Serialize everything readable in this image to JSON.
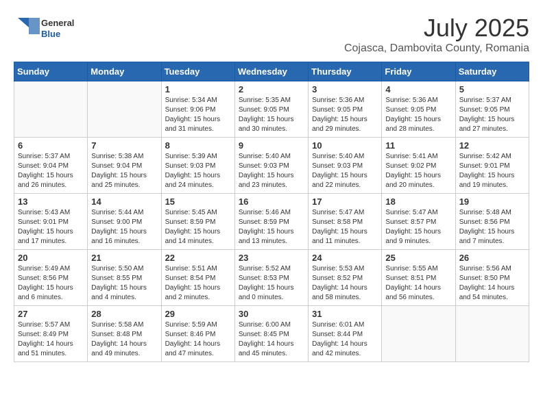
{
  "logo": {
    "general": "General",
    "blue": "Blue"
  },
  "title": "July 2025",
  "subtitle": "Cojasca, Dambovita County, Romania",
  "days_of_week": [
    "Sunday",
    "Monday",
    "Tuesday",
    "Wednesday",
    "Thursday",
    "Friday",
    "Saturday"
  ],
  "weeks": [
    [
      {
        "day": "",
        "content": ""
      },
      {
        "day": "",
        "content": ""
      },
      {
        "day": "1",
        "content": "Sunrise: 5:34 AM\nSunset: 9:06 PM\nDaylight: 15 hours\nand 31 minutes."
      },
      {
        "day": "2",
        "content": "Sunrise: 5:35 AM\nSunset: 9:05 PM\nDaylight: 15 hours\nand 30 minutes."
      },
      {
        "day": "3",
        "content": "Sunrise: 5:36 AM\nSunset: 9:05 PM\nDaylight: 15 hours\nand 29 minutes."
      },
      {
        "day": "4",
        "content": "Sunrise: 5:36 AM\nSunset: 9:05 PM\nDaylight: 15 hours\nand 28 minutes."
      },
      {
        "day": "5",
        "content": "Sunrise: 5:37 AM\nSunset: 9:05 PM\nDaylight: 15 hours\nand 27 minutes."
      }
    ],
    [
      {
        "day": "6",
        "content": "Sunrise: 5:37 AM\nSunset: 9:04 PM\nDaylight: 15 hours\nand 26 minutes."
      },
      {
        "day": "7",
        "content": "Sunrise: 5:38 AM\nSunset: 9:04 PM\nDaylight: 15 hours\nand 25 minutes."
      },
      {
        "day": "8",
        "content": "Sunrise: 5:39 AM\nSunset: 9:03 PM\nDaylight: 15 hours\nand 24 minutes."
      },
      {
        "day": "9",
        "content": "Sunrise: 5:40 AM\nSunset: 9:03 PM\nDaylight: 15 hours\nand 23 minutes."
      },
      {
        "day": "10",
        "content": "Sunrise: 5:40 AM\nSunset: 9:03 PM\nDaylight: 15 hours\nand 22 minutes."
      },
      {
        "day": "11",
        "content": "Sunrise: 5:41 AM\nSunset: 9:02 PM\nDaylight: 15 hours\nand 20 minutes."
      },
      {
        "day": "12",
        "content": "Sunrise: 5:42 AM\nSunset: 9:01 PM\nDaylight: 15 hours\nand 19 minutes."
      }
    ],
    [
      {
        "day": "13",
        "content": "Sunrise: 5:43 AM\nSunset: 9:01 PM\nDaylight: 15 hours\nand 17 minutes."
      },
      {
        "day": "14",
        "content": "Sunrise: 5:44 AM\nSunset: 9:00 PM\nDaylight: 15 hours\nand 16 minutes."
      },
      {
        "day": "15",
        "content": "Sunrise: 5:45 AM\nSunset: 8:59 PM\nDaylight: 15 hours\nand 14 minutes."
      },
      {
        "day": "16",
        "content": "Sunrise: 5:46 AM\nSunset: 8:59 PM\nDaylight: 15 hours\nand 13 minutes."
      },
      {
        "day": "17",
        "content": "Sunrise: 5:47 AM\nSunset: 8:58 PM\nDaylight: 15 hours\nand 11 minutes."
      },
      {
        "day": "18",
        "content": "Sunrise: 5:47 AM\nSunset: 8:57 PM\nDaylight: 15 hours\nand 9 minutes."
      },
      {
        "day": "19",
        "content": "Sunrise: 5:48 AM\nSunset: 8:56 PM\nDaylight: 15 hours\nand 7 minutes."
      }
    ],
    [
      {
        "day": "20",
        "content": "Sunrise: 5:49 AM\nSunset: 8:56 PM\nDaylight: 15 hours\nand 6 minutes."
      },
      {
        "day": "21",
        "content": "Sunrise: 5:50 AM\nSunset: 8:55 PM\nDaylight: 15 hours\nand 4 minutes."
      },
      {
        "day": "22",
        "content": "Sunrise: 5:51 AM\nSunset: 8:54 PM\nDaylight: 15 hours\nand 2 minutes."
      },
      {
        "day": "23",
        "content": "Sunrise: 5:52 AM\nSunset: 8:53 PM\nDaylight: 15 hours\nand 0 minutes."
      },
      {
        "day": "24",
        "content": "Sunrise: 5:53 AM\nSunset: 8:52 PM\nDaylight: 14 hours\nand 58 minutes."
      },
      {
        "day": "25",
        "content": "Sunrise: 5:55 AM\nSunset: 8:51 PM\nDaylight: 14 hours\nand 56 minutes."
      },
      {
        "day": "26",
        "content": "Sunrise: 5:56 AM\nSunset: 8:50 PM\nDaylight: 14 hours\nand 54 minutes."
      }
    ],
    [
      {
        "day": "27",
        "content": "Sunrise: 5:57 AM\nSunset: 8:49 PM\nDaylight: 14 hours\nand 51 minutes."
      },
      {
        "day": "28",
        "content": "Sunrise: 5:58 AM\nSunset: 8:48 PM\nDaylight: 14 hours\nand 49 minutes."
      },
      {
        "day": "29",
        "content": "Sunrise: 5:59 AM\nSunset: 8:46 PM\nDaylight: 14 hours\nand 47 minutes."
      },
      {
        "day": "30",
        "content": "Sunrise: 6:00 AM\nSunset: 8:45 PM\nDaylight: 14 hours\nand 45 minutes."
      },
      {
        "day": "31",
        "content": "Sunrise: 6:01 AM\nSunset: 8:44 PM\nDaylight: 14 hours\nand 42 minutes."
      },
      {
        "day": "",
        "content": ""
      },
      {
        "day": "",
        "content": ""
      }
    ]
  ]
}
